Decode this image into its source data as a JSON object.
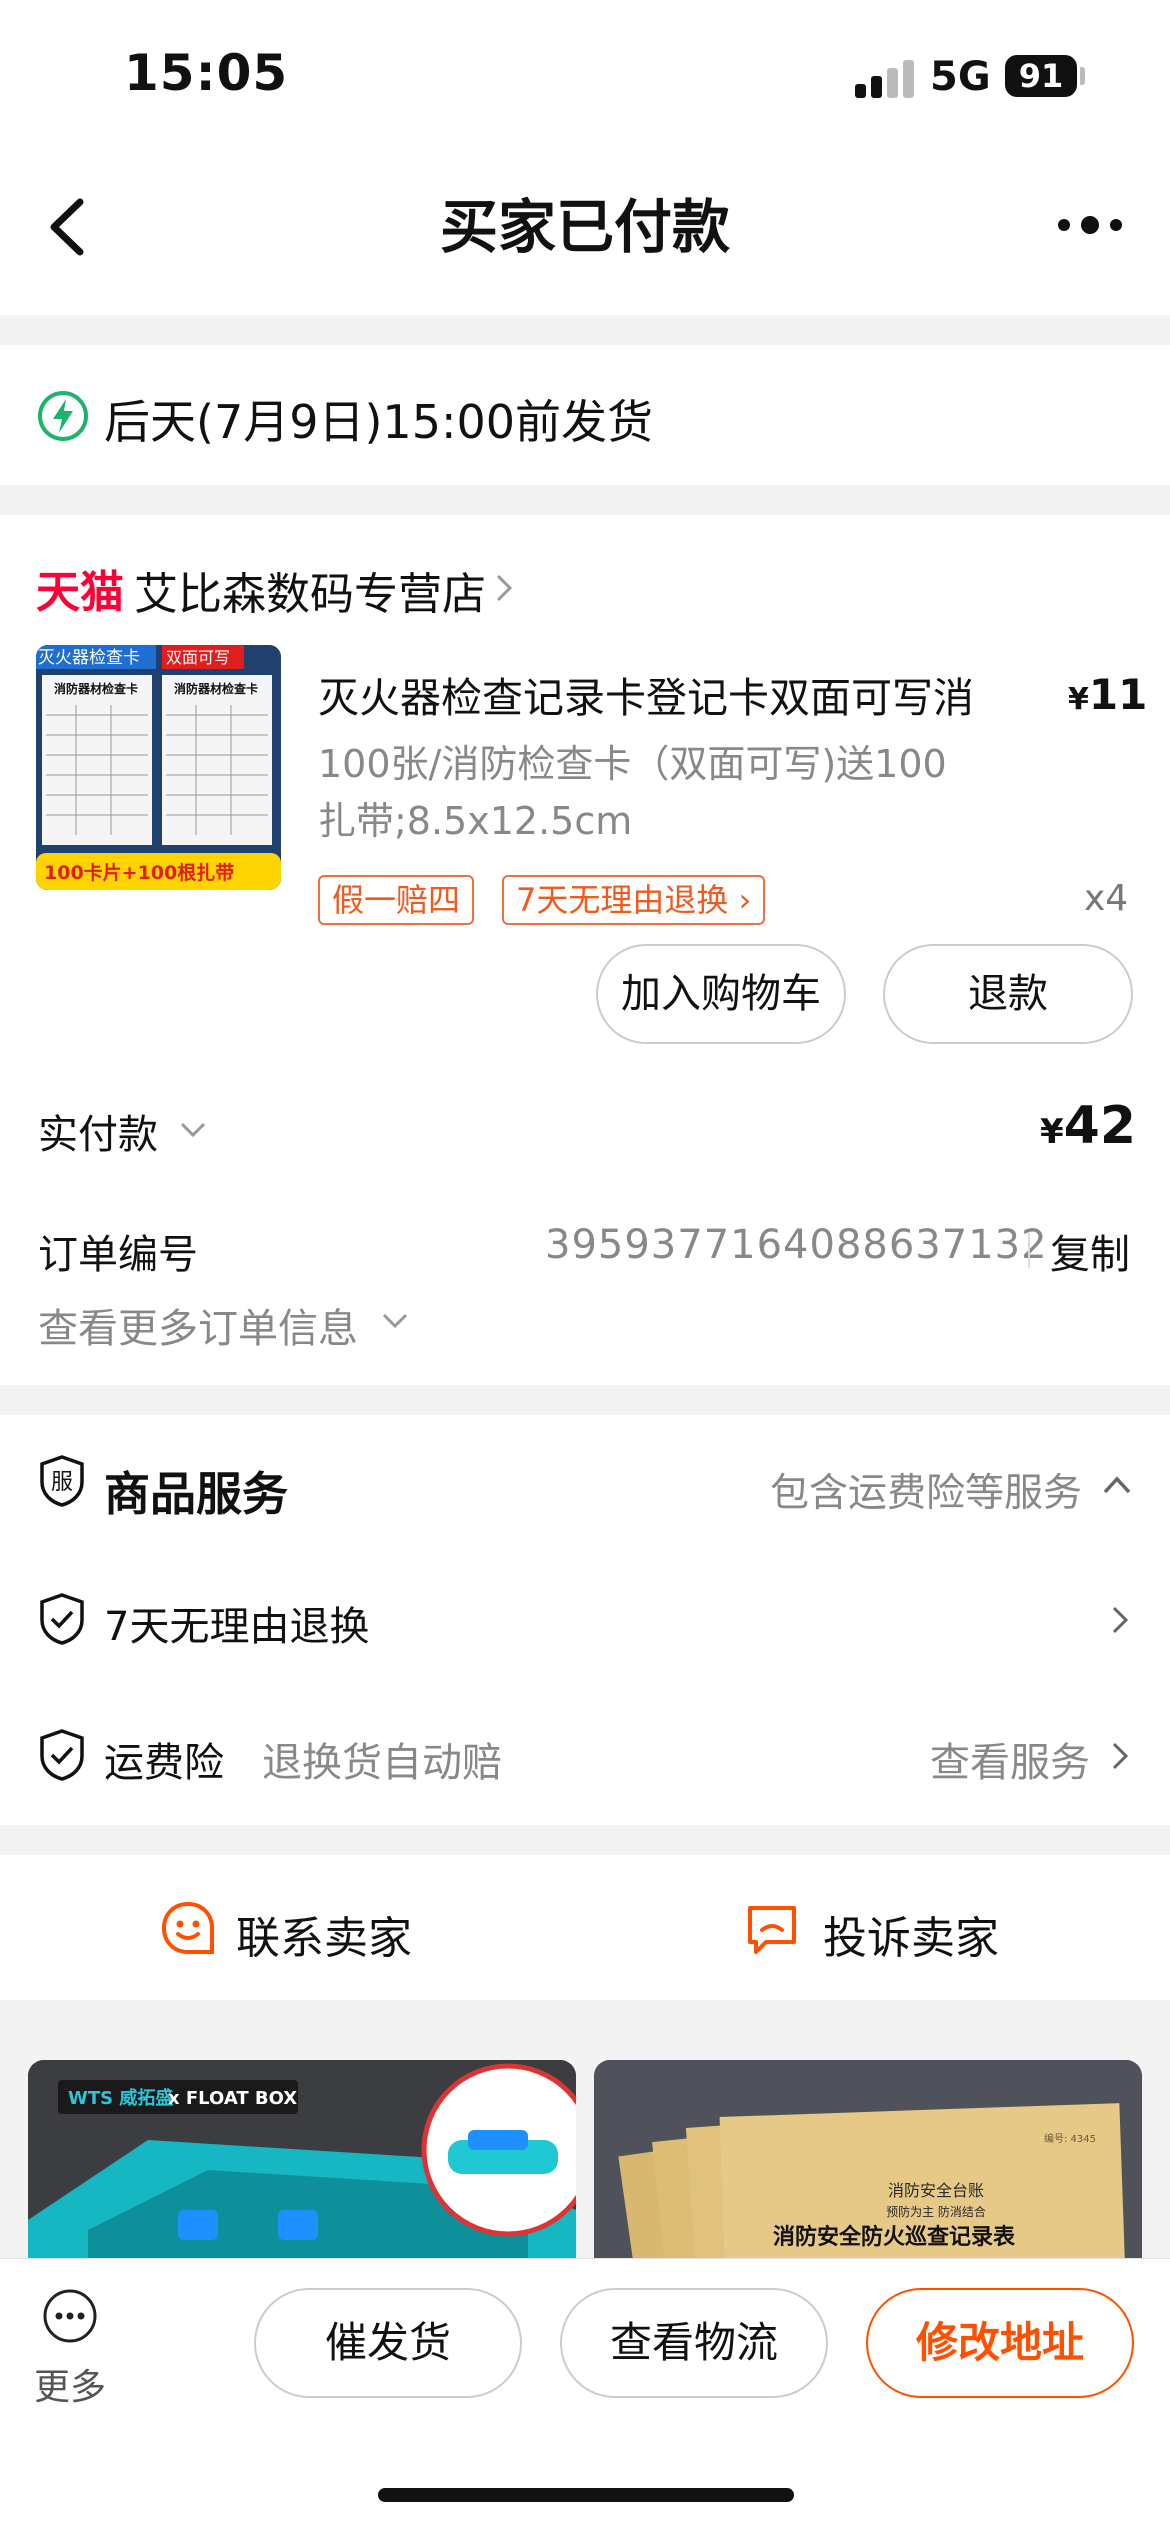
{
  "status_bar": {
    "time": "15:05",
    "network": "5G",
    "battery": "91"
  },
  "nav": {
    "title": "买家已付款",
    "back_icon": "chevron-left-icon",
    "more_icon": "more-dots-icon"
  },
  "shipping": {
    "icon": "lightning-icon",
    "text": "后天(7月9日)15:00前发货"
  },
  "store": {
    "platform": "天猫",
    "name": "艾比森数码专营店"
  },
  "product": {
    "image_texts": [
      "灭火器检查卡",
      "双面可写",
      "消防器材检查卡",
      "消防器材检查卡",
      "100卡片+100根扎带"
    ],
    "name": "灭火器检查记录卡登记卡双面可写消",
    "price_symbol": "¥",
    "price": "11",
    "spec": "100张/消防检查卡（双面可写)送100扎带;8.5x12.5cm",
    "tags": [
      "假一赔四",
      "7天无理由退换"
    ],
    "quantity": "x4",
    "add_to_cart": "加入购物车",
    "refund": "退款"
  },
  "payment": {
    "label": "实付款",
    "symbol": "¥",
    "amount": "42"
  },
  "order": {
    "number_label": "订单编号",
    "number": "3959377164088637132",
    "copy": "复制",
    "more_info": "查看更多订单信息"
  },
  "services": {
    "badge": "服",
    "title": "商品服务",
    "summary": "包含运费险等服务",
    "items": [
      {
        "label": "7天无理由退换",
        "sub": "",
        "action": ""
      },
      {
        "label": "运费险",
        "sub": "退换货自动赔",
        "action": "查看服务"
      }
    ]
  },
  "contact": {
    "contact_seller": "联系卖家",
    "complain_seller": "投诉卖家"
  },
  "recommendations": [
    {
      "texts": [
        "WTS 威拓盛",
        "x FLOAT BOX"
      ]
    },
    {
      "texts": [
        "编号: 4345",
        "消防安全台账",
        "预防为主 防消结合",
        "消防安全防火巡查记录表"
      ]
    }
  ],
  "bottom_bar": {
    "more": "更多",
    "urge": "催发货",
    "logistics": "查看物流",
    "modify_address": "修改地址"
  },
  "colors": {
    "accent": "#ff5000",
    "tmall_red": "#ff0036",
    "shipping_green": "#1db36b"
  }
}
